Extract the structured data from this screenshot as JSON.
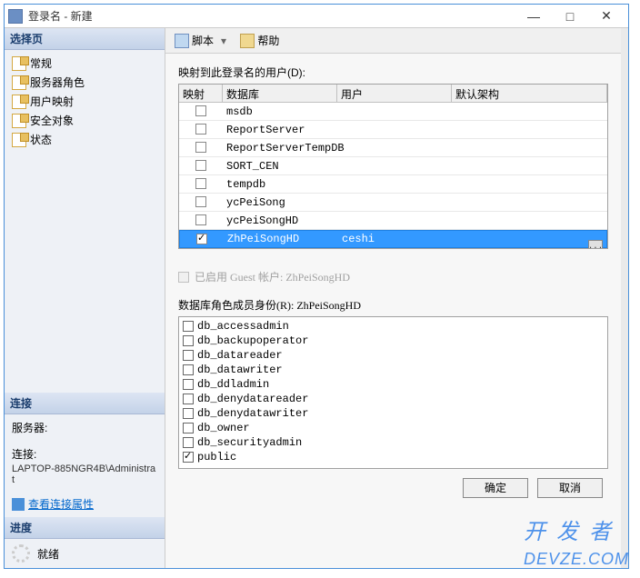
{
  "window": {
    "title": "登录名 - 新建",
    "min_label": "—",
    "max_label": "□",
    "close_label": "✕"
  },
  "left": {
    "select_page_header": "选择页",
    "nav_items": [
      "常规",
      "服务器角色",
      "用户映射",
      "安全对象",
      "状态"
    ],
    "conn_header": "连接",
    "server_label": "服务器:",
    "server_value": "",
    "conn_label": "连接:",
    "conn_value": "LAPTOP-885NGR4B\\Administrat",
    "view_props_link": "查看连接属性",
    "progress_header": "进度",
    "status_text": "就绪"
  },
  "toolbar": {
    "script_label": "脚本",
    "dropdown": "▾",
    "help_label": "帮助"
  },
  "mapping": {
    "label": "映射到此登录名的用户(D):",
    "columns": {
      "map": "映射",
      "db": "数据库",
      "user": "用户",
      "schema": "默认架构"
    },
    "rows": [
      {
        "checked": false,
        "db": "msdb",
        "user": "",
        "schema": ""
      },
      {
        "checked": false,
        "db": "ReportServer",
        "user": "",
        "schema": ""
      },
      {
        "checked": false,
        "db": "ReportServerTempDB",
        "user": "",
        "schema": ""
      },
      {
        "checked": false,
        "db": "SORT_CEN",
        "user": "",
        "schema": ""
      },
      {
        "checked": false,
        "db": "tempdb",
        "user": "",
        "schema": ""
      },
      {
        "checked": false,
        "db": "ycPeiSong",
        "user": "",
        "schema": ""
      },
      {
        "checked": false,
        "db": "ycPeiSongHD",
        "user": "",
        "schema": ""
      },
      {
        "checked": true,
        "db": "ZhPeiSongHD",
        "user": "ceshi",
        "schema": "",
        "selected": true
      }
    ]
  },
  "guest": {
    "label_prefix": "已启用 Guest 帐户: ",
    "db": "ZhPeiSongHD"
  },
  "roles": {
    "label_prefix": "数据库角色成员身份(R): ",
    "db": "ZhPeiSongHD",
    "items": [
      {
        "checked": false,
        "name": "db_accessadmin"
      },
      {
        "checked": false,
        "name": "db_backupoperator"
      },
      {
        "checked": false,
        "name": "db_datareader"
      },
      {
        "checked": false,
        "name": "db_datawriter"
      },
      {
        "checked": false,
        "name": "db_ddladmin"
      },
      {
        "checked": false,
        "name": "db_denydatareader"
      },
      {
        "checked": false,
        "name": "db_denydatawriter"
      },
      {
        "checked": false,
        "name": "db_owner"
      },
      {
        "checked": false,
        "name": "db_securityadmin"
      },
      {
        "checked": true,
        "name": "public"
      }
    ]
  },
  "buttons": {
    "ok": "确定",
    "cancel": "取消"
  },
  "watermark": {
    "cn": "开发者",
    "en": "DEVZE.COM"
  }
}
